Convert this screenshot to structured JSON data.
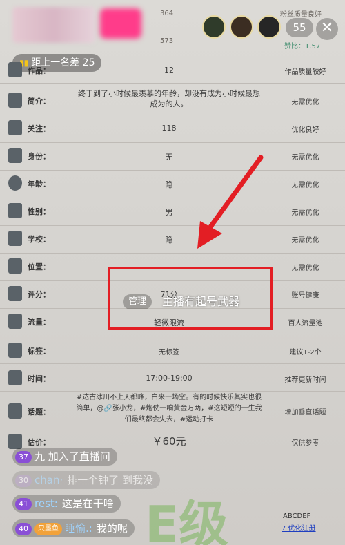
{
  "top": {
    "num1": "364",
    "num2": "573",
    "right_top_text": "粉丝质量良好",
    "right_sub": "赞比：1.57",
    "viewer_count": "55",
    "close_glyph": "✕"
  },
  "rank_pill": {
    "text": "距上一名差 25"
  },
  "rows": [
    {
      "label": "作品：",
      "value": "12",
      "result": "作品质量较好"
    },
    {
      "label": "简介：",
      "value": "终于到了小时候最羡慕的年龄，却没有成为小时候最想成为的人。",
      "result": "无需优化"
    },
    {
      "label": "关注：",
      "value": "118",
      "result": "优化良好"
    },
    {
      "label": "身份：",
      "value": "无",
      "result": "无需优化"
    },
    {
      "label": "年龄：",
      "value": "隐",
      "result": "无需优化"
    },
    {
      "label": "性别：",
      "value": "男",
      "result": "无需优化"
    },
    {
      "label": "学校：",
      "value": "隐",
      "result": "无需优化"
    },
    {
      "label": "位置：",
      "value": "",
      "result": "无需优化"
    },
    {
      "label": "评分：",
      "value": "71分",
      "result": "账号健康"
    },
    {
      "label": "流量：",
      "value": "轻微限流",
      "result": "百人流量池"
    },
    {
      "label": "标签：",
      "value": "无标签",
      "result": "建议1-2个"
    },
    {
      "label": "时间：",
      "value": "17:00-19:00",
      "result": "推荐更新时间"
    },
    {
      "label": "话题：",
      "value": "#达古冰川不上天都峰，白来一场空。有的时候快乐其实也很简单，@🔗张小龙，#炮仗一响黄金万两，#这短短的一生我们最终都会失去，#运动打卡",
      "result": "增加垂直话题"
    },
    {
      "label": "估价：",
      "value": "￥60元",
      "result": "仅供参考"
    }
  ],
  "overlay": {
    "manage_badge": "管理",
    "caption": "主播有起号武器"
  },
  "chat": [
    {
      "level": "37",
      "user": "",
      "text": "九 加入了直播间"
    },
    {
      "level": "30",
      "user": "chan·",
      "text": "排一个钟了 到我没"
    },
    {
      "level": "41",
      "user": "rest:",
      "text": "这是在干啥"
    },
    {
      "level": "40",
      "fan_badge": "只墨鱼",
      "user": "睡愉.:",
      "text": "我的呢"
    }
  ],
  "corner": {
    "line1": "ABCDEF",
    "line2": "7 优化注册"
  },
  "colors": {
    "accent_red": "#e31e24",
    "level_purple": "#8a4fd6",
    "username_blue": "#9fd4ff"
  }
}
